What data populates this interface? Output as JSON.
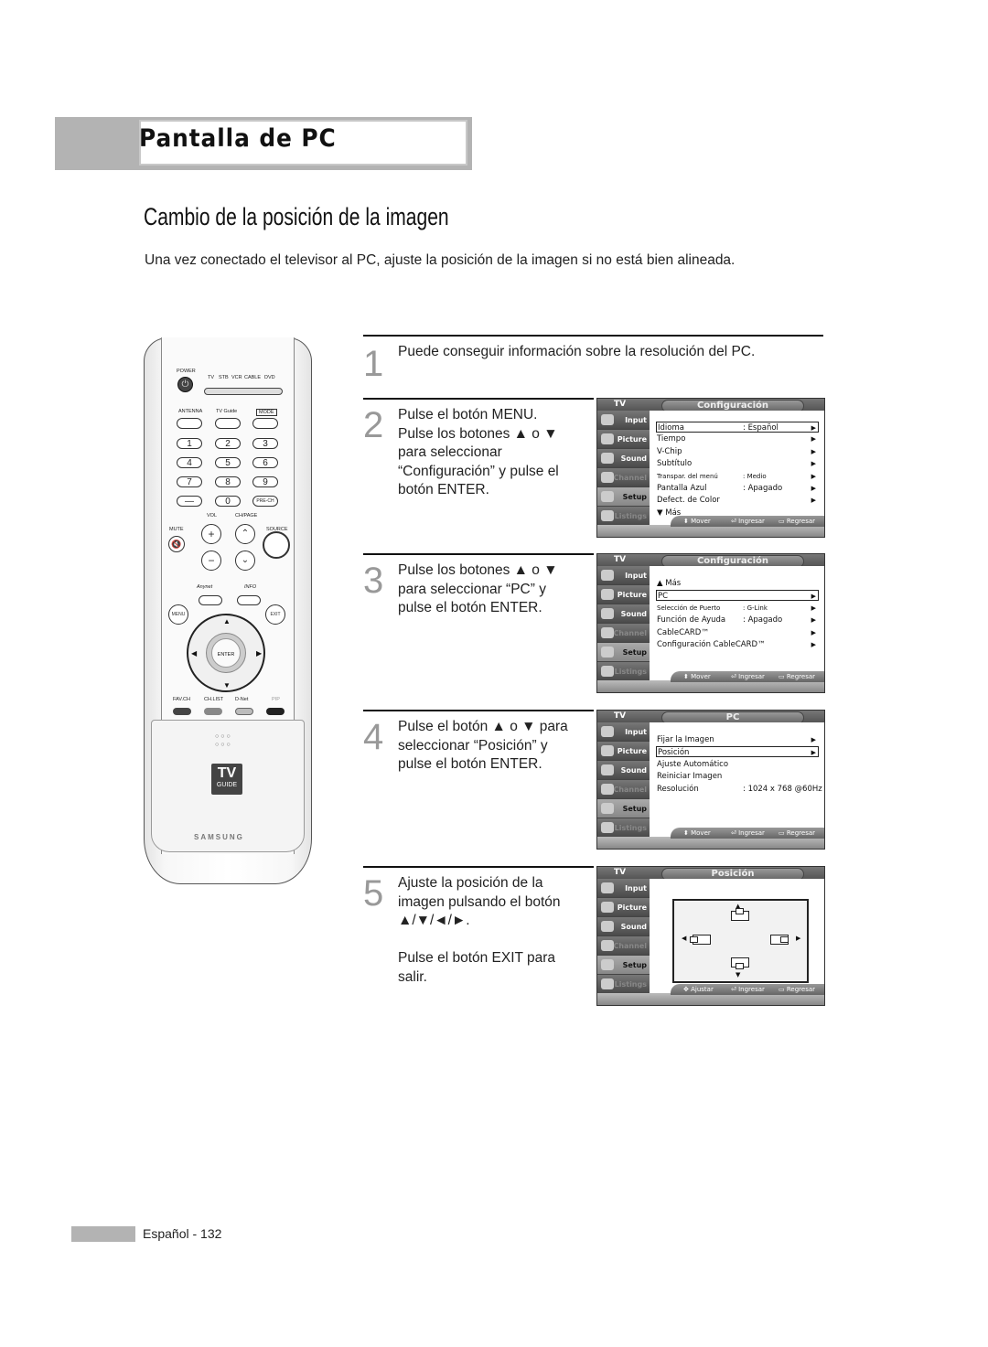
{
  "header": {
    "title": "Pantalla de PC"
  },
  "section": {
    "title": "Cambio de la posición de la imagen",
    "intro": "Una vez conectado el televisor al PC, ajuste la posición de la imagen si no está bien alineada."
  },
  "remote": {
    "power": "POWER",
    "modes": [
      "TV",
      "STB",
      "VCR",
      "CABLE",
      "DVD"
    ],
    "top_buttons": [
      "ANTENNA",
      "TV Guide",
      "MODE"
    ],
    "digits": [
      "1",
      "2",
      "3",
      "4",
      "5",
      "6",
      "7",
      "8",
      "9",
      "—",
      "0",
      "PRE-CH"
    ],
    "vol": "VOL",
    "chpage": "CH/PAGE",
    "mute": "MUTE",
    "source": "SOURCE",
    "anynet": "Anynet",
    "info": "INFO",
    "menu": "MENU",
    "exit": "EXIT",
    "enter": "ENTER",
    "bottom_labels": [
      "FAV.CH",
      "CH.LIST",
      "D-Net",
      "PIP"
    ],
    "tvguide_top": "TV",
    "tvguide_bottom": "GUIDE",
    "brand": "SAMSUNG"
  },
  "steps": [
    {
      "num": "1",
      "lines": [
        "Puede conseguir información sobre la resolución del PC."
      ]
    },
    {
      "num": "2",
      "lines": [
        "Pulse el botón MENU.",
        "Pulse los botones ▲ o ▼",
        "para seleccionar",
        "“Configuración” y pulse el",
        "botón ENTER."
      ]
    },
    {
      "num": "3",
      "lines": [
        "Pulse los botones ▲ o ▼",
        "para seleccionar “PC” y",
        "pulse el botón ENTER."
      ]
    },
    {
      "num": "4",
      "lines": [
        "Pulse el botón ▲ o ▼ para",
        "seleccionar “Posición” y",
        "pulse el botón ENTER."
      ]
    },
    {
      "num": "5",
      "lines": [
        "Ajuste la posición de la",
        "imagen pulsando el botón",
        "▲/▼/◄/►.",
        "",
        "Pulse el botón EXIT para",
        "salir."
      ]
    }
  ],
  "osd_common": {
    "tv": "TV",
    "sidebar": [
      "Input",
      "Picture",
      "Sound",
      "Channel",
      "Setup",
      "Listings"
    ],
    "move": "Mover",
    "adjust": "Ajustar",
    "enter": "Ingresar",
    "back": "Regresar"
  },
  "osd_screens": [
    {
      "title": "Configuración",
      "rows": [
        {
          "label": "Idioma",
          "value": ": Español",
          "arrow": "▶",
          "highlight": true
        },
        {
          "label": "Tiempo",
          "value": "",
          "arrow": "▶"
        },
        {
          "label": "V-Chip",
          "value": "",
          "arrow": "▶"
        },
        {
          "label": "Subtítulo",
          "value": "",
          "arrow": "▶"
        },
        {
          "label": "Transpar. del menú",
          "value": ": Medio",
          "arrow": "▶"
        },
        {
          "label": "Pantalla Azul",
          "value": ": Apagado",
          "arrow": "▶"
        },
        {
          "label": "Defect. de Color",
          "value": "",
          "arrow": "▶"
        },
        {
          "label": "▼ Más",
          "value": "",
          "arrow": ""
        }
      ]
    },
    {
      "title": "Configuración",
      "rows": [
        {
          "label": "▲ Más",
          "value": "",
          "arrow": ""
        },
        {
          "label": "PC",
          "value": "",
          "arrow": "▶",
          "highlight": true
        },
        {
          "label": "Selección de Puerto",
          "value": ": G-Link",
          "arrow": "▶"
        },
        {
          "label": "Función de Ayuda",
          "value": ": Apagado",
          "arrow": "▶"
        },
        {
          "label": "CableCARD™",
          "value": "",
          "arrow": "▶"
        },
        {
          "label": "Configuración CableCARD™",
          "value": "",
          "arrow": "▶"
        }
      ]
    },
    {
      "title": "PC",
      "rows": [
        {
          "label": "Fijar la Imagen",
          "value": "",
          "arrow": "▶"
        },
        {
          "label": "Posición",
          "value": "",
          "arrow": "▶",
          "highlight": true
        },
        {
          "label": "Ajuste Automático",
          "value": "",
          "arrow": ""
        },
        {
          "label": "Reiniciar Imagen",
          "value": "",
          "arrow": ""
        },
        {
          "label": "Resolución",
          "value": ": 1024 x 768 @60Hz",
          "arrow": ""
        }
      ]
    },
    {
      "title": "Posición",
      "rows": []
    }
  ],
  "footer": {
    "page": "Español - 132"
  }
}
